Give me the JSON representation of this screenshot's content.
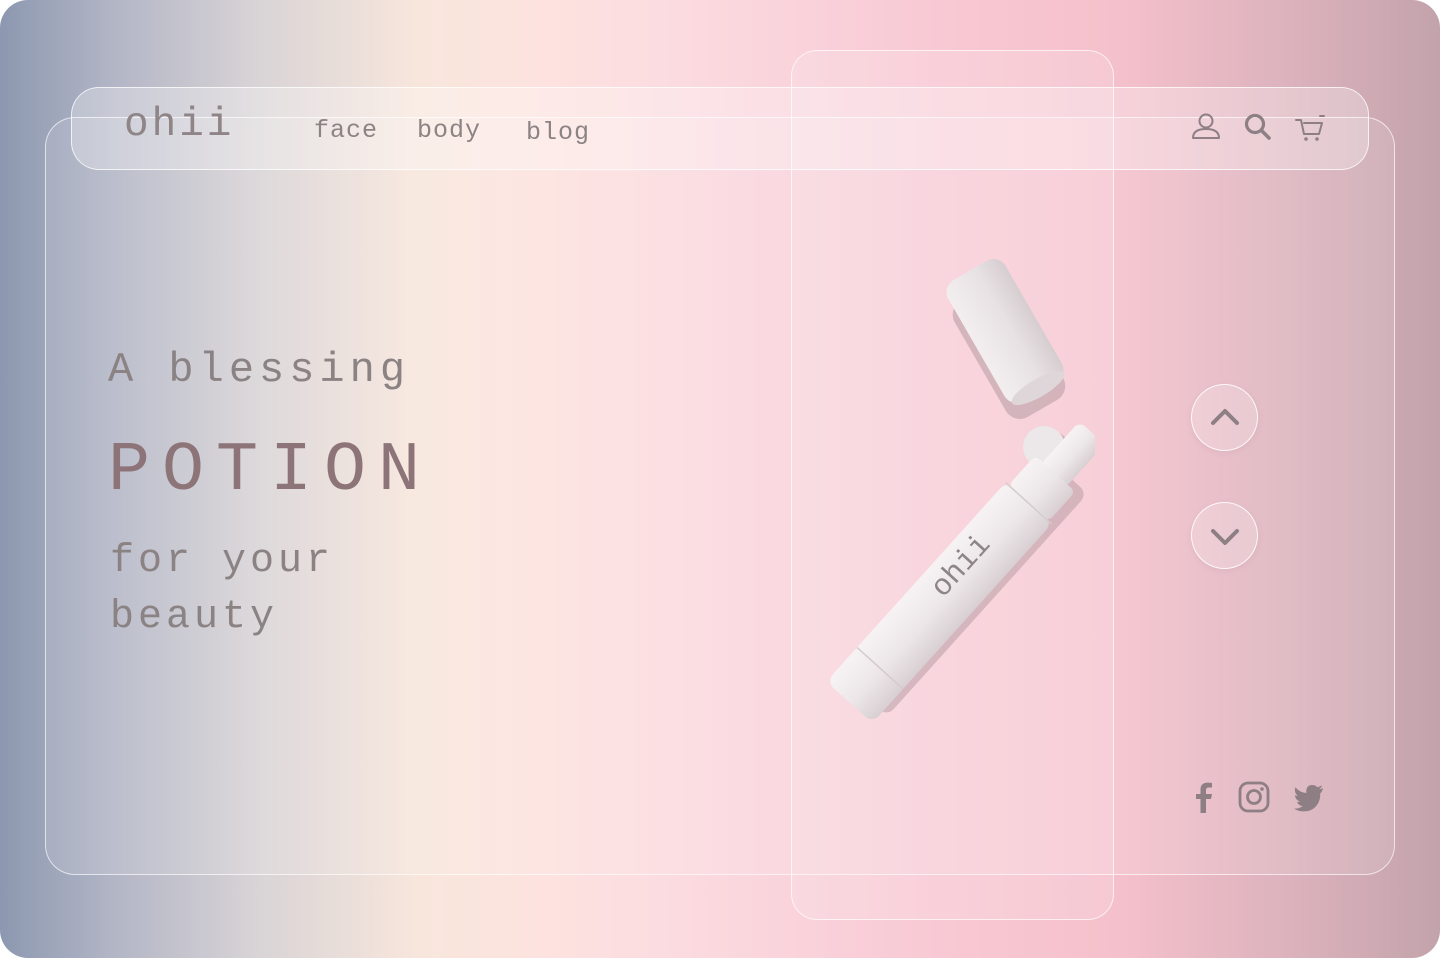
{
  "brand": {
    "logo_text": "ohii"
  },
  "nav": {
    "links": [
      {
        "label": "face"
      },
      {
        "label": "body"
      },
      {
        "label": "blog"
      }
    ],
    "icons": [
      "user-icon",
      "search-icon",
      "cart-icon"
    ]
  },
  "hero": {
    "line1": "A blessing",
    "line2": "POTION",
    "line3": "for your beauty"
  },
  "product": {
    "label": "ohii"
  },
  "carousel": {
    "controls": [
      "chevron-up-icon",
      "chevron-down-icon"
    ]
  },
  "social": {
    "icons": [
      "facebook-icon",
      "instagram-icon",
      "twitter-icon"
    ]
  },
  "colors": {
    "text_muted": "#8f8587",
    "accent_title": "#8c7479",
    "icon": "#8d7f84",
    "gradient_left": "#8c98b0",
    "gradient_mid": "#f8e6dc",
    "gradient_pink": "#f8c8d3",
    "gradient_right": "#c3a3ab"
  }
}
